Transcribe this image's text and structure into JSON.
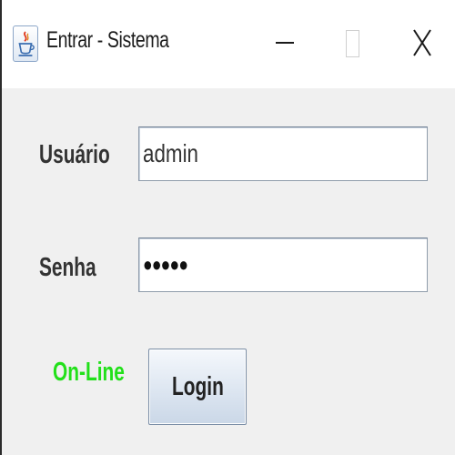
{
  "window": {
    "title": "Entrar - Sistema",
    "icon": "java-cup-icon",
    "controls": {
      "minimize": "minimize-icon",
      "maximize": "maximize-icon",
      "close": "close-icon"
    }
  },
  "form": {
    "username_label": "Usuário",
    "username_value": "admin",
    "password_label": "Senha",
    "password_display": "●●●●●",
    "status_text": "On-Line",
    "login_label": "Login"
  },
  "colors": {
    "status_online": "#22e01a",
    "background": "#f0f0f0",
    "titlebar": "#ffffff"
  }
}
